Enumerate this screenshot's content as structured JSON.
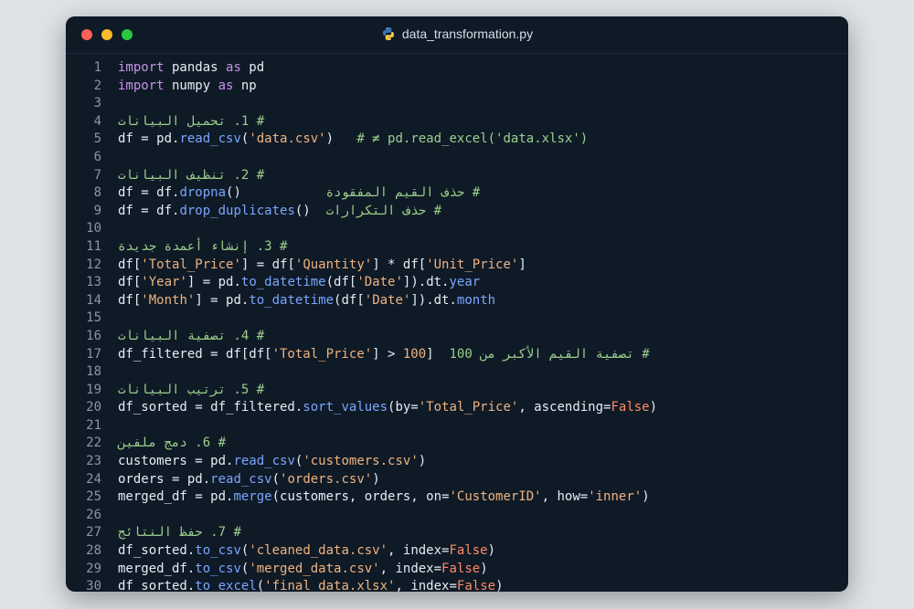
{
  "window": {
    "title": "data_transformation.py",
    "file_icon": "python-icon"
  },
  "lines": [
    {
      "n": "1",
      "tokens": [
        [
          "kw",
          "import"
        ],
        [
          "p",
          " pandas "
        ],
        [
          "kw",
          "as"
        ],
        [
          "p",
          " pd"
        ]
      ]
    },
    {
      "n": "2",
      "tokens": [
        [
          "kw",
          "import"
        ],
        [
          "p",
          " numpy "
        ],
        [
          "kw",
          "as"
        ],
        [
          "p",
          " np"
        ]
      ]
    },
    {
      "n": "3",
      "tokens": []
    },
    {
      "n": "4",
      "tokens": [
        [
          "cm",
          "# 1. تحميل البيانات"
        ]
      ]
    },
    {
      "n": "5",
      "tokens": [
        [
          "p",
          "df = pd."
        ],
        [
          "fn",
          "read_csv"
        ],
        [
          "p",
          "("
        ],
        [
          "str",
          "'data.csv'"
        ],
        [
          "p",
          ")   "
        ],
        [
          "cm",
          "# ≠ pd.read_excel('data.xlsx')"
        ]
      ]
    },
    {
      "n": "6",
      "tokens": []
    },
    {
      "n": "7",
      "tokens": [
        [
          "cm",
          "# 2. تنظيف البيانات"
        ]
      ]
    },
    {
      "n": "8",
      "tokens": [
        [
          "p",
          "df = df."
        ],
        [
          "fn",
          "dropna"
        ],
        [
          "p",
          "()           "
        ],
        [
          "cm",
          "# حذف القيم المفقودة"
        ]
      ]
    },
    {
      "n": "9",
      "tokens": [
        [
          "p",
          "df = df."
        ],
        [
          "fn",
          "drop_duplicates"
        ],
        [
          "p",
          "()  "
        ],
        [
          "cm",
          "# حذف التكرارات"
        ]
      ]
    },
    {
      "n": "10",
      "tokens": []
    },
    {
      "n": "11",
      "tokens": [
        [
          "cm",
          "# 3. إنشاء أعمدة جديدة"
        ]
      ]
    },
    {
      "n": "12",
      "tokens": [
        [
          "p",
          "df["
        ],
        [
          "str",
          "'Total_Price'"
        ],
        [
          "p",
          "] = df["
        ],
        [
          "str",
          "'Quantity'"
        ],
        [
          "p",
          "] * df["
        ],
        [
          "str",
          "'Unit_Price'"
        ],
        [
          "p",
          "]"
        ]
      ]
    },
    {
      "n": "13",
      "tokens": [
        [
          "p",
          "df["
        ],
        [
          "str",
          "'Year'"
        ],
        [
          "p",
          "] = pd."
        ],
        [
          "fn",
          "to_datetime"
        ],
        [
          "p",
          "(df["
        ],
        [
          "str",
          "'Date'"
        ],
        [
          "p",
          "]).dt."
        ],
        [
          "fn",
          "year"
        ]
      ]
    },
    {
      "n": "14",
      "tokens": [
        [
          "p",
          "df["
        ],
        [
          "str",
          "'Month'"
        ],
        [
          "p",
          "] = pd."
        ],
        [
          "fn",
          "to_datetime"
        ],
        [
          "p",
          "(df["
        ],
        [
          "str",
          "'Date'"
        ],
        [
          "p",
          "]).dt."
        ],
        [
          "fn",
          "month"
        ]
      ]
    },
    {
      "n": "15",
      "tokens": []
    },
    {
      "n": "16",
      "tokens": [
        [
          "cm",
          "# 4. تصفية البيانات"
        ]
      ]
    },
    {
      "n": "17",
      "tokens": [
        [
          "p",
          "df_filtered = df[df["
        ],
        [
          "str",
          "'Total_Price'"
        ],
        [
          "p",
          "] > "
        ],
        [
          "num",
          "100"
        ],
        [
          "p",
          "]  "
        ],
        [
          "cm",
          "# تصفية القيم الأكبر من 100"
        ]
      ]
    },
    {
      "n": "18",
      "tokens": []
    },
    {
      "n": "19",
      "tokens": [
        [
          "cm",
          "# 5. ترتيب البيانات"
        ]
      ]
    },
    {
      "n": "20",
      "tokens": [
        [
          "p",
          "df_sorted = df_filtered."
        ],
        [
          "fn",
          "sort_values"
        ],
        [
          "p",
          "(by="
        ],
        [
          "str",
          "'Total_Price'"
        ],
        [
          "p",
          ", ascending="
        ],
        [
          "bool",
          "False"
        ],
        [
          "p",
          ")"
        ]
      ]
    },
    {
      "n": "21",
      "tokens": []
    },
    {
      "n": "22",
      "tokens": [
        [
          "cm",
          "# 6. دمج ملفين"
        ]
      ]
    },
    {
      "n": "23",
      "tokens": [
        [
          "p",
          "customers = pd."
        ],
        [
          "fn",
          "read_csv"
        ],
        [
          "p",
          "("
        ],
        [
          "str",
          "'customers.csv'"
        ],
        [
          "p",
          ")"
        ]
      ]
    },
    {
      "n": "24",
      "tokens": [
        [
          "p",
          "orders = pd."
        ],
        [
          "fn",
          "read_csv"
        ],
        [
          "p",
          "("
        ],
        [
          "str",
          "'orders.csv'"
        ],
        [
          "p",
          ")"
        ]
      ]
    },
    {
      "n": "25",
      "tokens": [
        [
          "p",
          "merged_df = pd."
        ],
        [
          "fn",
          "merge"
        ],
        [
          "p",
          "(customers, orders, on="
        ],
        [
          "str",
          "'CustomerID'"
        ],
        [
          "p",
          ", how="
        ],
        [
          "str",
          "'inner'"
        ],
        [
          "p",
          ")"
        ]
      ]
    },
    {
      "n": "26",
      "tokens": []
    },
    {
      "n": "27",
      "tokens": [
        [
          "cm",
          "# 7. حفظ النتائج"
        ]
      ]
    },
    {
      "n": "28",
      "tokens": [
        [
          "p",
          "df_sorted."
        ],
        [
          "fn",
          "to_csv"
        ],
        [
          "p",
          "("
        ],
        [
          "str",
          "'cleaned_data.csv'"
        ],
        [
          "p",
          ", index="
        ],
        [
          "bool",
          "False"
        ],
        [
          "p",
          ")"
        ]
      ]
    },
    {
      "n": "29",
      "tokens": [
        [
          "p",
          "merged_df."
        ],
        [
          "fn",
          "to_csv"
        ],
        [
          "p",
          "("
        ],
        [
          "str",
          "'merged_data.csv'"
        ],
        [
          "p",
          ", index="
        ],
        [
          "bool",
          "False"
        ],
        [
          "p",
          ")"
        ]
      ]
    },
    {
      "n": "30",
      "tokens": [
        [
          "p",
          "df_sorted."
        ],
        [
          "fn",
          "to_excel"
        ],
        [
          "p",
          "("
        ],
        [
          "str",
          "'final_data.xlsx'"
        ],
        [
          "p",
          ", index="
        ],
        [
          "bool",
          "False"
        ],
        [
          "p",
          ")"
        ]
      ]
    }
  ]
}
